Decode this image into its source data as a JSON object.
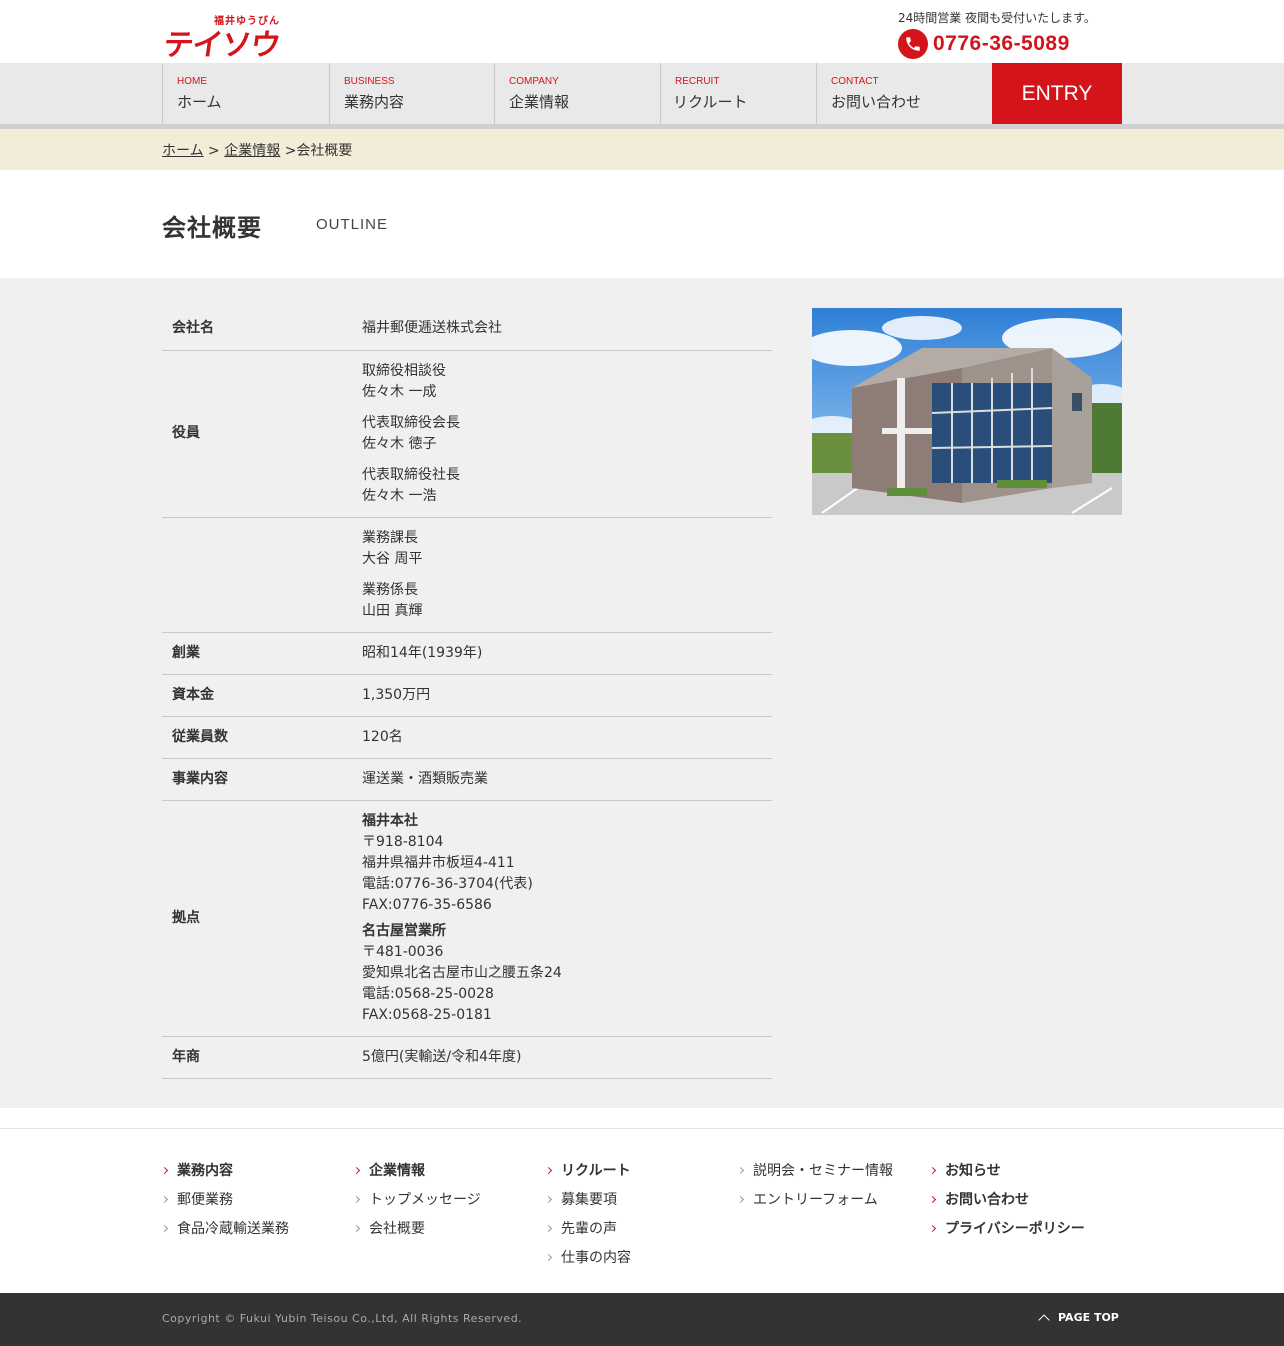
{
  "header": {
    "logo_sub": "福井ゆうびん",
    "logo_main": "テイソウ",
    "tel_note": "24時間営業 夜間も受付いたします。",
    "tel": "0776-36-5089"
  },
  "nav": {
    "items": [
      {
        "en": "HOME",
        "ja": "ホーム"
      },
      {
        "en": "BUSINESS",
        "ja": "業務内容"
      },
      {
        "en": "COMPANY",
        "ja": "企業情報"
      },
      {
        "en": "RECRUIT",
        "ja": "リクルート"
      },
      {
        "en": "CONTACT",
        "ja": "お問い合わせ"
      }
    ],
    "entry": "ENTRY"
  },
  "breadcrumb": {
    "home": "ホーム",
    "sep": ">",
    "company": "企業情報",
    "current": "会社概要"
  },
  "title": {
    "ja": "会社概要",
    "en": "OUTLINE"
  },
  "outline": {
    "company_name": {
      "label": "会社名",
      "value": "福井郵便逓送株式会社"
    },
    "officers": {
      "label": "役員",
      "entries": [
        {
          "title": "取締役相談役",
          "name": "佐々木 一成"
        },
        {
          "title": "代表取締役会長",
          "name": "佐々木 徳子"
        },
        {
          "title": "代表取締役社長",
          "name": "佐々木 一浩"
        }
      ],
      "entries2": [
        {
          "title": "業務課長",
          "name": "大谷 周平"
        },
        {
          "title": "業務係長",
          "name": "山田 真輝"
        }
      ]
    },
    "founded": {
      "label": "創業",
      "value": "昭和14年(1939年)"
    },
    "capital": {
      "label": "資本金",
      "value": "1,350万円"
    },
    "employees": {
      "label": "従業員数",
      "value": "120名"
    },
    "business": {
      "label": "事業内容",
      "value": "運送業・酒類販売業"
    },
    "offices": {
      "label": "拠点",
      "hq": {
        "name": "福井本社",
        "zip": "〒918-8104",
        "addr": "福井県福井市板垣4-411",
        "tel": "電話:0776-36-3704(代表)",
        "fax": "FAX:0776-35-6586"
      },
      "nagoya": {
        "name": "名古屋営業所",
        "zip": "〒481-0036",
        "addr": "愛知県北名古屋市山之腰五条24",
        "tel": "電話:0568-25-0028",
        "fax": "FAX:0568-25-0181"
      }
    },
    "revenue": {
      "label": "年商",
      "value": "5億円(実輸送/令和4年度)"
    }
  },
  "footer": {
    "col1": [
      "業務内容",
      "郵便業務",
      "食品冷蔵輸送業務"
    ],
    "col2": [
      "企業情報",
      "トップメッセージ",
      "会社概要"
    ],
    "col3": [
      "リクルート",
      "募集要項",
      "先輩の声",
      "仕事の内容"
    ],
    "col4": [
      "説明会・セミナー情報",
      "エントリーフォーム"
    ],
    "col5": [
      "お知らせ",
      "お問い合わせ",
      "プライバシーポリシー"
    ],
    "copyright": "Copyright © Fukui Yubin Teisou Co.,Ltd, All Rights Reserved.",
    "pagetop": "PAGE TOP"
  },
  "colors": {
    "brand_red": "#d3141b",
    "breadcrumb_bg": "#f3ecd9",
    "main_bg": "#f0f0f0",
    "footer_dark": "#333333"
  }
}
